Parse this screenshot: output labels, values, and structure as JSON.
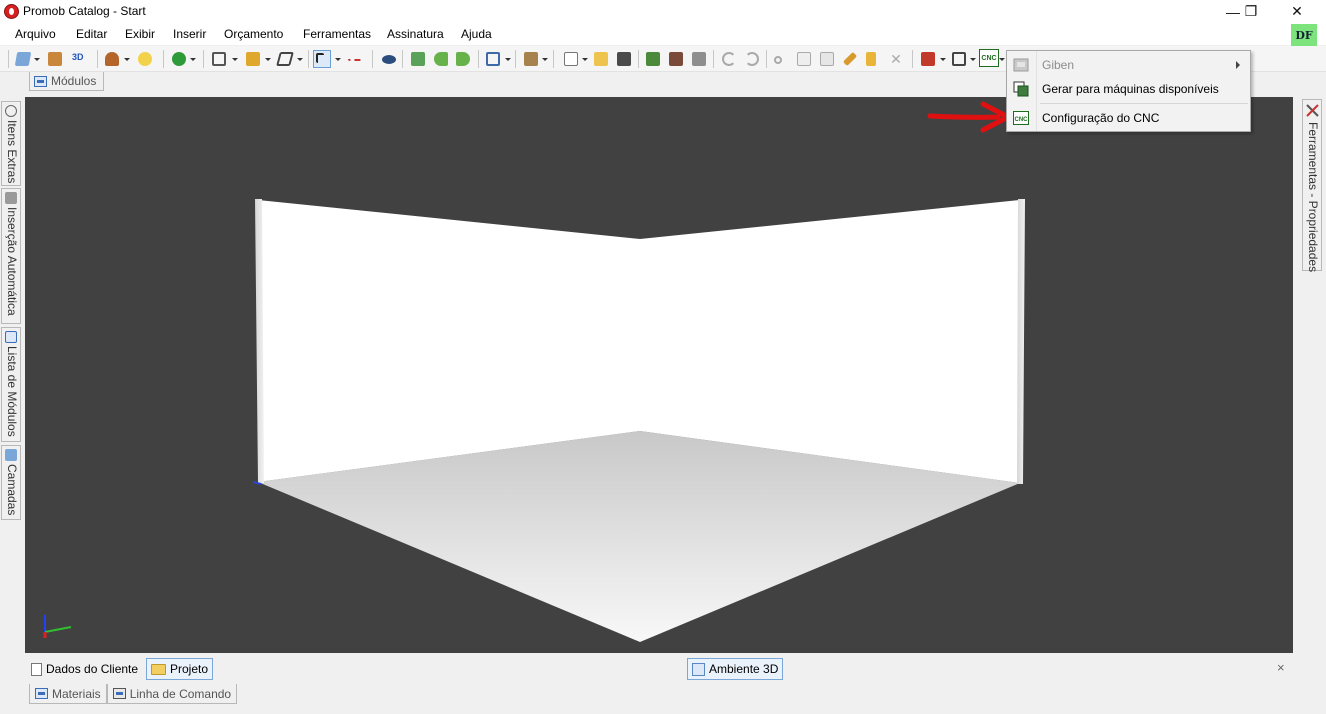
{
  "window": {
    "title": "Promob Catalog -  Start",
    "buttons": {
      "minimize": "—",
      "restore": "❐",
      "close": "✕"
    }
  },
  "menubar": {
    "items": [
      "Arquivo",
      "Editar",
      "Exibir",
      "Inserir",
      "Orçamento",
      "Ferramentas",
      "Assinatura",
      "Ajuda"
    ]
  },
  "user": {
    "initials": "DF"
  },
  "toolbar": {
    "label_3d": "3D",
    "cnc_label": "CNC"
  },
  "panels": {
    "top_tab": "Módulos",
    "left_tabs": [
      "Itens Extras",
      "Inserção Automática",
      "Lista de Módulos",
      "Camadas"
    ],
    "right_tab": "Ferramentas - Propriedades"
  },
  "dropdown": {
    "items": [
      {
        "label": "Giben",
        "enabled": false,
        "submenu": true,
        "icon": "giben-icon"
      },
      {
        "label": "Gerar para máquinas disponíveis",
        "enabled": true,
        "submenu": false,
        "icon": "generate-icon"
      },
      {
        "label": "Configuração do CNC",
        "enabled": true,
        "submenu": false,
        "icon": "cnc-config-icon"
      }
    ]
  },
  "bottom_tabs": {
    "dados_cliente": "Dados do Cliente",
    "projeto": "Projeto",
    "ambiente_3d": "Ambiente 3D",
    "close": "×"
  },
  "status_tabs": [
    "Materiais",
    "Linha de Comando"
  ],
  "colors": {
    "viewport_bg": "#414141",
    "annotation_arrow": "#e01010",
    "avatar_bg": "#7de37d"
  }
}
